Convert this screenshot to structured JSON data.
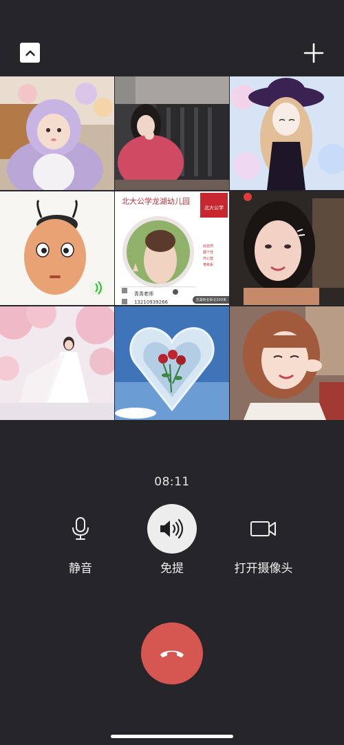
{
  "header": {
    "collapse_icon": "chevron-up-icon",
    "add_icon": "plus-icon"
  },
  "participants": [
    {
      "avatar": "girl in plush bunny hoodie"
    },
    {
      "avatar": "woman making heart hand gesture"
    },
    {
      "avatar": "anime girl in purple hat"
    },
    {
      "avatar": "cartoon face with pigtails"
    },
    {
      "avatar": "kindergarten teacher business card",
      "card_title": "北大公学龙湖幼儿园",
      "logo_text": "北大公学",
      "traits": [
        "尚自然",
        "展个性",
        "开心智",
        "育栋系"
      ],
      "name": "青青老师",
      "phone": "13210939266",
      "address": "龙湖商业街北500米"
    },
    {
      "avatar": "woman selfie with face stickers"
    },
    {
      "avatar": "bride under cherry blossoms"
    },
    {
      "avatar": "crystal heart with roses"
    },
    {
      "avatar": "woman with bangs smiling"
    }
  ],
  "call": {
    "timer": "08:11"
  },
  "controls": {
    "mute": {
      "label": "静音",
      "icon": "microphone-icon"
    },
    "speaker": {
      "label": "免提",
      "icon": "speaker-icon"
    },
    "camera": {
      "label": "打开摄像头",
      "icon": "video-camera-icon"
    }
  },
  "hangup": {
    "icon": "hang-up-phone-icon"
  },
  "colors": {
    "background": "#262529",
    "hangup": "#d65752",
    "speaker_button": "#ededed"
  }
}
